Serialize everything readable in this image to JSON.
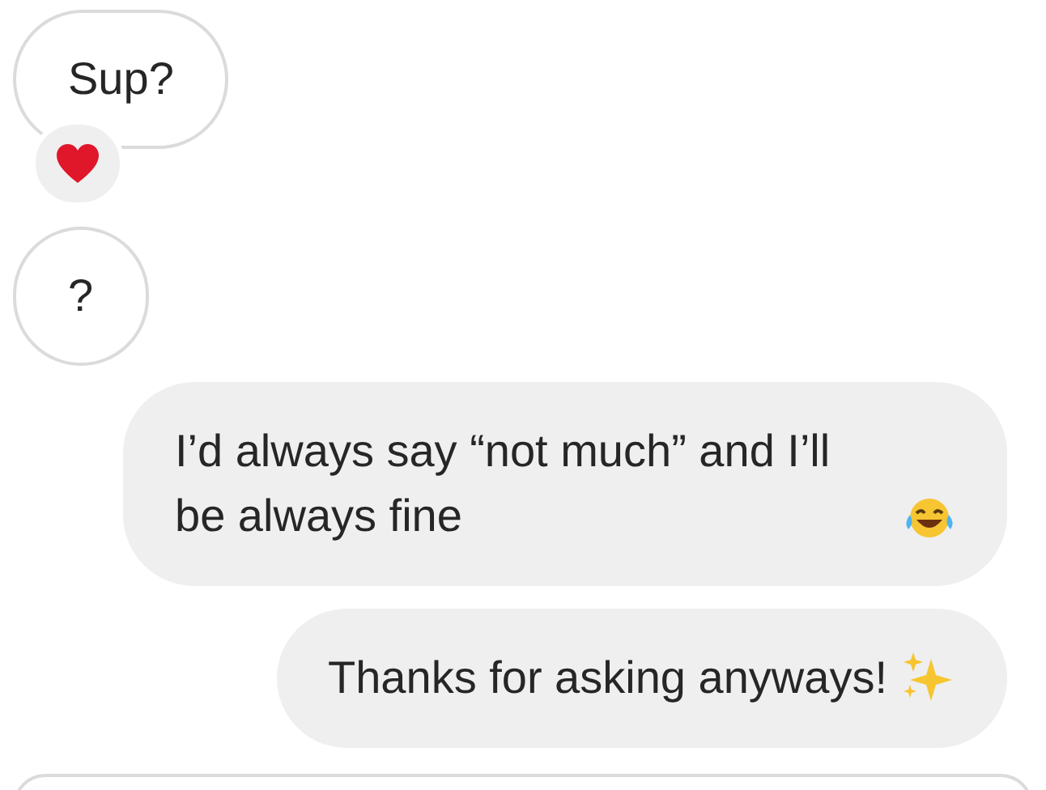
{
  "messages": [
    {
      "kind": "received",
      "text": "Sup?",
      "reaction": {
        "kind": "heart"
      }
    },
    {
      "kind": "received",
      "text": "?"
    },
    {
      "kind": "sent",
      "text": "I’d always say “not much” and I’ll be always fine",
      "emoji": {
        "kind": "laughing"
      }
    },
    {
      "kind": "sent",
      "text": "Thanks for asking anyways!",
      "emoji": {
        "kind": "sparkles"
      }
    }
  ]
}
